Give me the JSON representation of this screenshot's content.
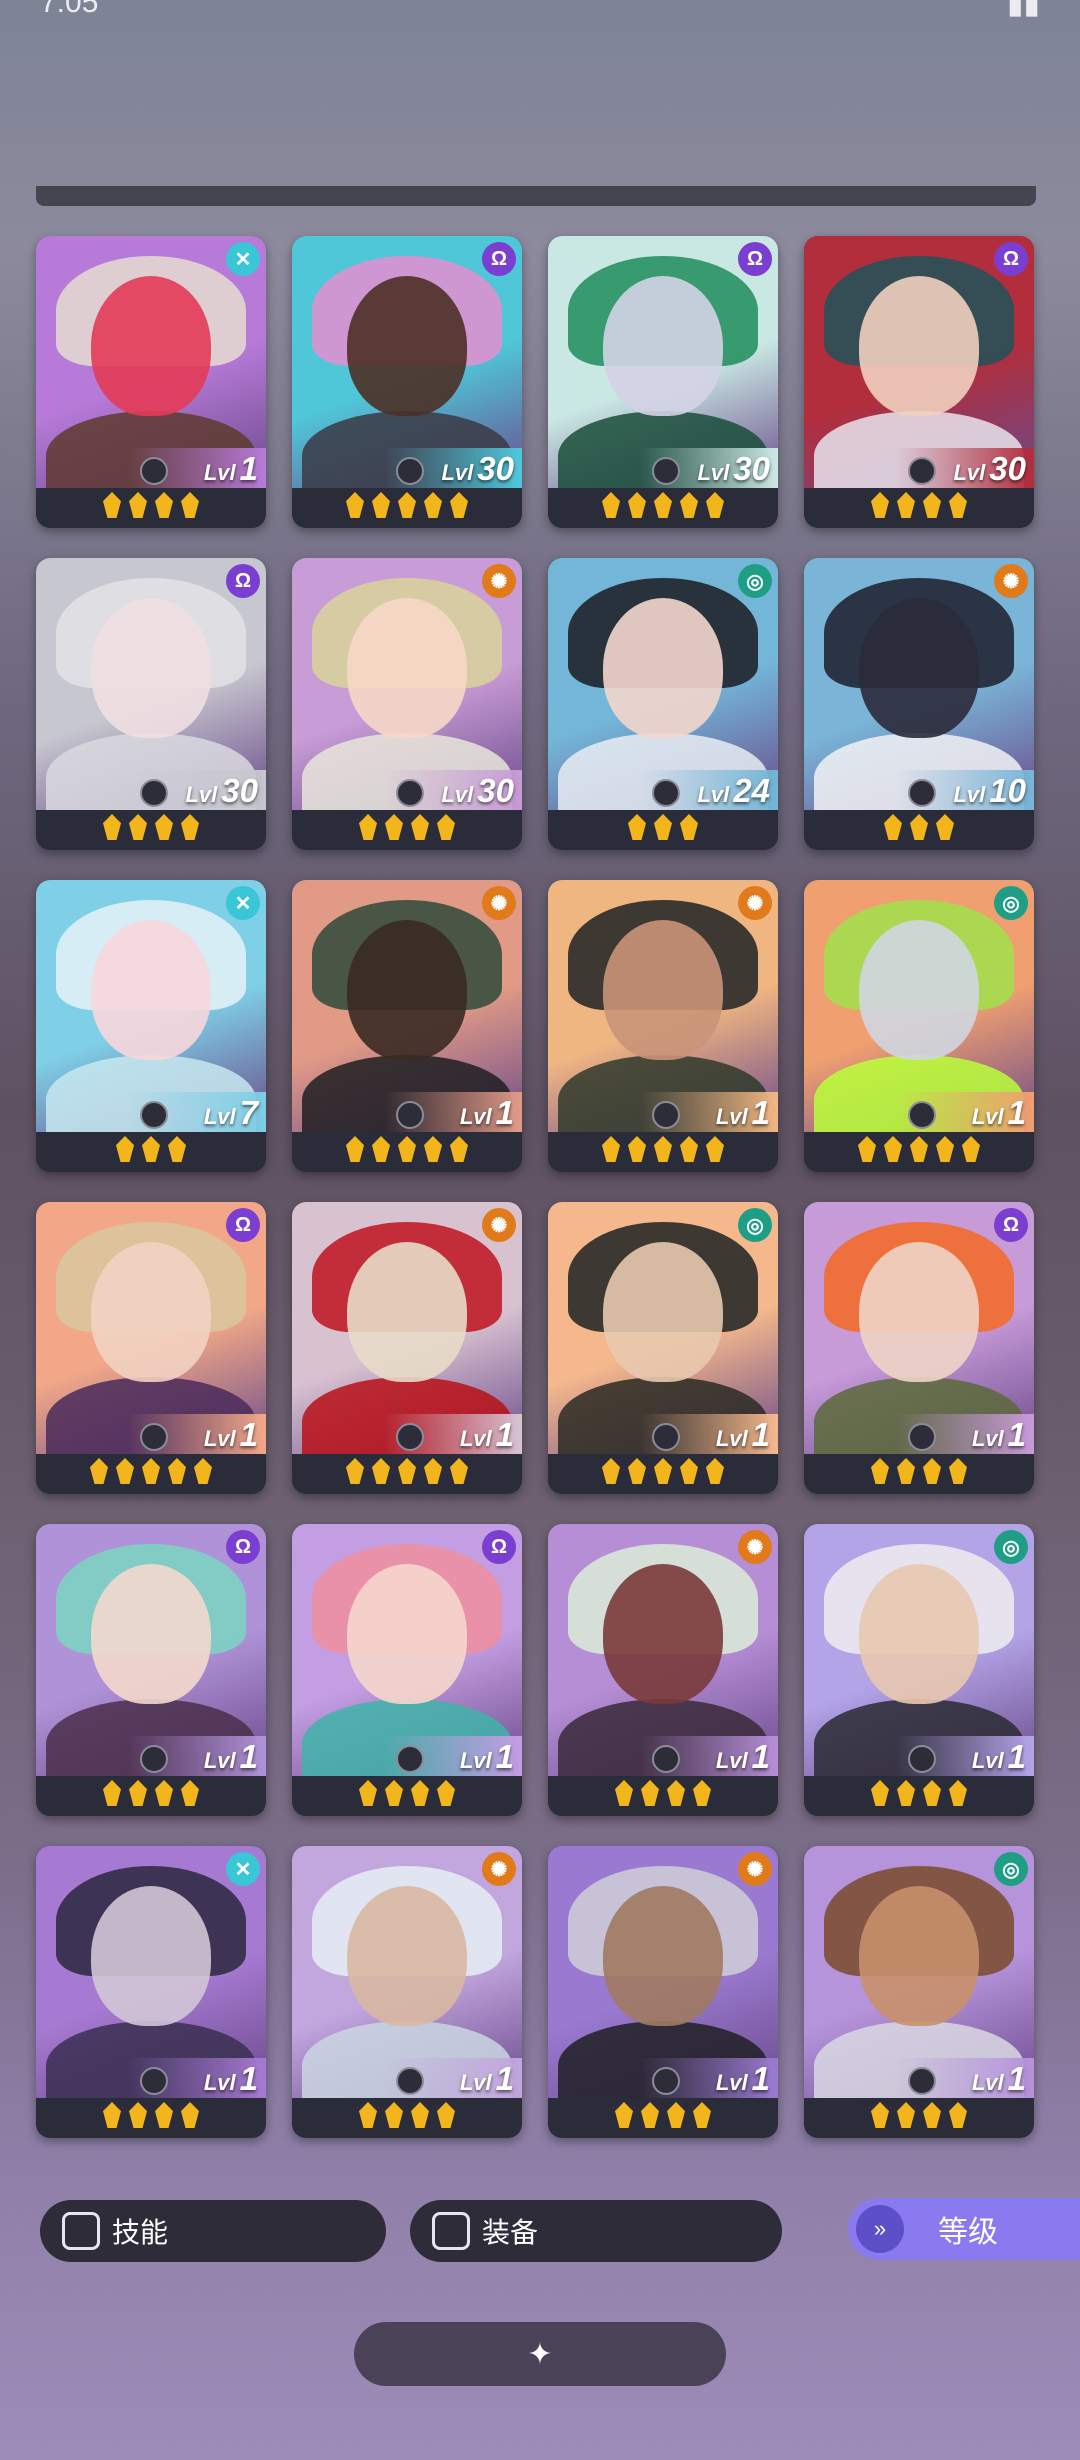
{
  "status_bar": {
    "left": "7:05",
    "right": "▮▮"
  },
  "heroes": [
    {
      "level": "1",
      "level_label": "Lvl",
      "stars": 4,
      "faction": "cross",
      "faction_color": "#39c6d6",
      "bg": "#b77ad8",
      "hair": "#e6ddd0",
      "face": "#e33b56",
      "body": "#5e3a2e"
    },
    {
      "level": "30",
      "level_label": "Lvl",
      "stars": 5,
      "faction": "mind",
      "faction_color": "#7a3fd0",
      "bg": "#4fc7d9",
      "hair": "#e58ed0",
      "face": "#4b3026",
      "body": "#3a3a44"
    },
    {
      "level": "30",
      "level_label": "Lvl",
      "stars": 5,
      "faction": "mind",
      "faction_color": "#7a3fd0",
      "bg": "#c9e8e3",
      "hair": "#1e8c5a",
      "face": "#d4d3e6",
      "body": "#1a4d3a"
    },
    {
      "level": "30",
      "level_label": "Lvl",
      "stars": 4,
      "faction": "mind",
      "faction_color": "#7a3fd0",
      "bg": "#b22e3c",
      "hair": "#1e5258",
      "face": "#f1d0bf",
      "body": "#e9e4ec"
    },
    {
      "level": "30",
      "level_label": "Lvl",
      "stars": 4,
      "faction": "mind",
      "faction_color": "#7a3fd0",
      "bg": "#c7c7cf",
      "hair": "#e2e2e6",
      "face": "#f0dfe2",
      "body": "#d9d9df"
    },
    {
      "level": "30",
      "level_label": "Lvl",
      "stars": 4,
      "faction": "sun",
      "faction_color": "#e07a1a",
      "bg": "#c89cd6",
      "hair": "#d8d39a",
      "face": "#f6d8c6",
      "body": "#e8e6da"
    },
    {
      "level": "24",
      "level_label": "Lvl",
      "stars": 3,
      "faction": "swirl",
      "faction_color": "#1f9e86",
      "bg": "#73b6d8",
      "hair": "#1b1b22",
      "face": "#f3d6cc",
      "body": "#e8ecf2"
    },
    {
      "level": "10",
      "level_label": "Lvl",
      "stars": 3,
      "faction": "sun",
      "faction_color": "#e07a1a",
      "bg": "#7ab5d8",
      "hair": "#1d1d2c",
      "face": "#2a2a3a",
      "body": "#f2f2f4"
    },
    {
      "level": "7",
      "level_label": "Lvl",
      "stars": 3,
      "faction": "cross",
      "faction_color": "#39c6d6",
      "bg": "#7fcfe6",
      "hair": "#e6f2f8",
      "face": "#f7d7dc",
      "body": "#c7e8ef"
    },
    {
      "level": "1",
      "level_label": "Lvl",
      "stars": 5,
      "faction": "sun",
      "faction_color": "#e07a1a",
      "bg": "#e09a86",
      "hair": "#2f4a3a",
      "face": "#3a2a24",
      "body": "#1f1f22"
    },
    {
      "level": "1",
      "level_label": "Lvl",
      "stars": 5,
      "faction": "sun",
      "faction_color": "#e07a1a",
      "bg": "#f0b682",
      "hair": "#1f2226",
      "face": "#c99478",
      "body": "#2f3a2a"
    },
    {
      "level": "1",
      "level_label": "Lvl",
      "stars": 5,
      "faction": "swirl",
      "faction_color": "#1f9e86",
      "bg": "#f0a070",
      "hair": "#9fe24a",
      "face": "#cfd6e0",
      "body": "#b8ff3a"
    },
    {
      "level": "1",
      "level_label": "Lvl",
      "stars": 5,
      "faction": "mind",
      "faction_color": "#7a3fd0",
      "bg": "#f2a888",
      "hair": "#d8c8a0",
      "face": "#f2d2c2",
      "body": "#4a2a5a"
    },
    {
      "level": "1",
      "level_label": "Lvl",
      "stars": 5,
      "faction": "sun",
      "faction_color": "#e07a1a",
      "bg": "#d8c2d0",
      "hair": "#c0121e",
      "face": "#e8dcc8",
      "body": "#b81018"
    },
    {
      "level": "1",
      "level_label": "Lvl",
      "stars": 5,
      "faction": "swirl",
      "faction_color": "#1f9e86",
      "bg": "#f4b88c",
      "hair": "#1c2222",
      "face": "#e8c9ae",
      "body": "#2a2a22"
    },
    {
      "level": "1",
      "level_label": "Lvl",
      "stars": 4,
      "faction": "mind",
      "faction_color": "#7a3fd0",
      "bg": "#c79ad8",
      "hair": "#f46a22",
      "face": "#f0d4c6",
      "body": "#5a6a3a"
    },
    {
      "level": "1",
      "level_label": "Lvl",
      "stars": 4,
      "faction": "mind",
      "faction_color": "#7a3fd0",
      "bg": "#b092d8",
      "hair": "#7ad6c2",
      "face": "#f3d8cc",
      "body": "#4a2e4a"
    },
    {
      "level": "1",
      "level_label": "Lvl",
      "stars": 4,
      "faction": "mind",
      "faction_color": "#7a3fd0",
      "bg": "#c49ee2",
      "hair": "#ee8e9e",
      "face": "#f6d6cc",
      "body": "#3fb4a8"
    },
    {
      "level": "1",
      "level_label": "Lvl",
      "stars": 4,
      "faction": "sun",
      "faction_color": "#e07a1a",
      "bg": "#b68ed6",
      "hair": "#dcecd8",
      "face": "#7a3a3a",
      "body": "#3a2a3a"
    },
    {
      "level": "1",
      "level_label": "Lvl",
      "stars": 4,
      "faction": "swirl",
      "faction_color": "#1f9e86",
      "bg": "#b3a4e8",
      "hair": "#eeeeee",
      "face": "#e8c8b0",
      "body": "#2a2a32"
    },
    {
      "level": "1",
      "level_label": "Lvl",
      "stars": 4,
      "faction": "cross",
      "faction_color": "#39c6d6",
      "bg": "#a67ad2",
      "hair": "#2a2740",
      "face": "#d2c6d6",
      "body": "#3a2f52"
    },
    {
      "level": "1",
      "level_label": "Lvl",
      "stars": 4,
      "faction": "sun",
      "faction_color": "#e07a1a",
      "bg": "#c2a6de",
      "hair": "#e6eef4",
      "face": "#d8b8a2",
      "body": "#cad6e2"
    },
    {
      "level": "1",
      "level_label": "Lvl",
      "stars": 4,
      "faction": "sun",
      "faction_color": "#e07a1a",
      "bg": "#9a7ad0",
      "hair": "#cfcfd6",
      "face": "#a07a62",
      "body": "#202024"
    },
    {
      "level": "1",
      "level_label": "Lvl",
      "stars": 4,
      "faction": "swirl",
      "faction_color": "#1f9e86",
      "bg": "#b694dc",
      "hair": "#7a4a2a",
      "face": "#c8906a",
      "body": "#d8d8e2"
    }
  ],
  "filters": {
    "skill_label": "技能",
    "equip_label": "装备",
    "sort_label": "等级",
    "sort_icon": "double-chevron-down-icon"
  },
  "collapse_icon": "collapse-icon"
}
